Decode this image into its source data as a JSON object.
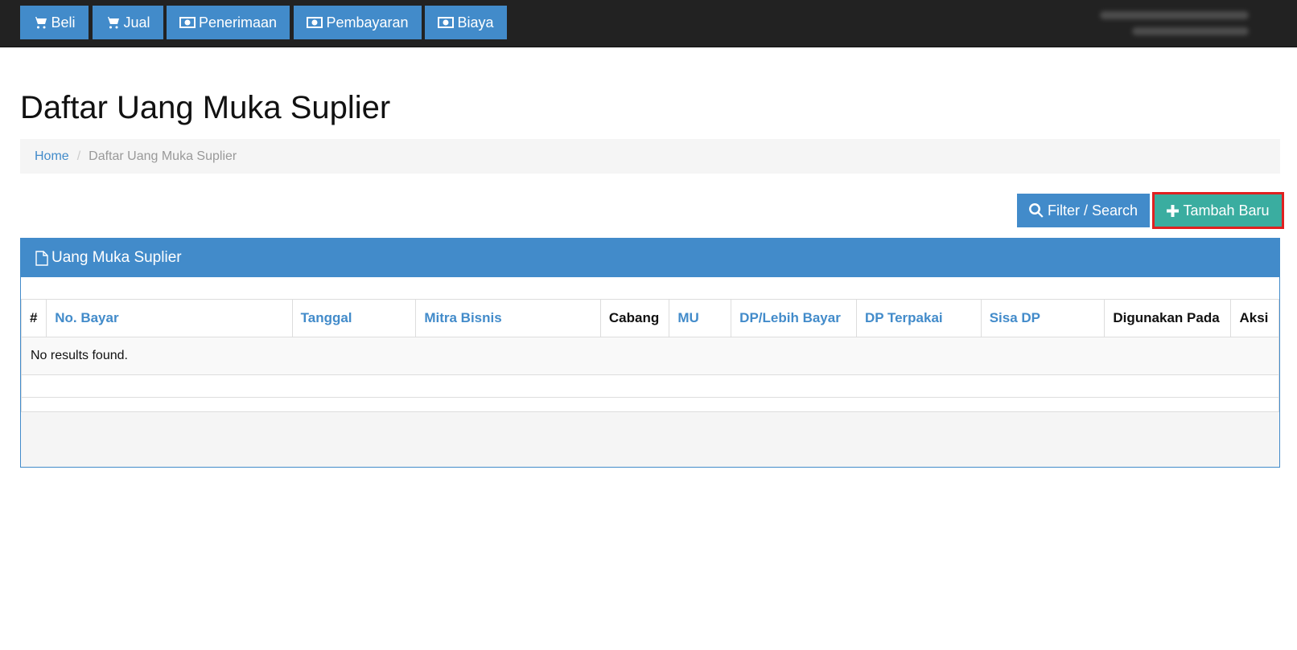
{
  "navbar": {
    "items": [
      {
        "label": "Beli",
        "icon": "shopping-cart-icon"
      },
      {
        "label": "Jual",
        "icon": "shopping-cart-icon"
      },
      {
        "label": "Penerimaan",
        "icon": "money-icon"
      },
      {
        "label": "Pembayaran",
        "icon": "money-icon"
      },
      {
        "label": "Biaya",
        "icon": "money-icon"
      }
    ]
  },
  "page": {
    "title": "Daftar Uang Muka Suplier"
  },
  "breadcrumb": {
    "home": "Home",
    "current": "Daftar Uang Muka Suplier"
  },
  "actions": {
    "filter_label": "Filter / Search",
    "filter_icon": "search-icon",
    "add_label": "Tambah Baru",
    "add_icon": "plus-icon"
  },
  "panel": {
    "title": "Uang Muka Suplier",
    "icon": "file-icon",
    "columns": [
      {
        "label": "#",
        "sortable": false
      },
      {
        "label": "No. Bayar",
        "sortable": true
      },
      {
        "label": "Tanggal",
        "sortable": true
      },
      {
        "label": "Mitra Bisnis",
        "sortable": true
      },
      {
        "label": "Cabang",
        "sortable": false
      },
      {
        "label": "MU",
        "sortable": true
      },
      {
        "label": "DP/Lebih Bayar",
        "sortable": true
      },
      {
        "label": "DP Terpakai",
        "sortable": true
      },
      {
        "label": "Sisa DP",
        "sortable": true
      },
      {
        "label": "Digunakan Pada",
        "sortable": false
      },
      {
        "label": "Aksi",
        "sortable": false
      }
    ],
    "empty_message": "No results found."
  },
  "colors": {
    "primary": "#428bca",
    "success": "#3aada0",
    "navbar_bg": "#222222",
    "highlight_border": "#e02020"
  }
}
